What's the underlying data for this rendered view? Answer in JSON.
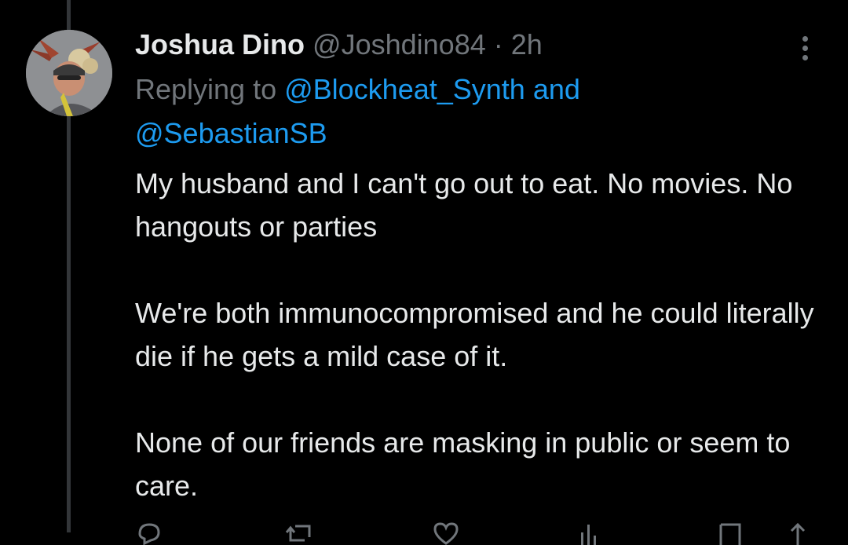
{
  "tweet": {
    "display_name": "Joshua Dino",
    "handle": "@Joshdino84",
    "separator": "·",
    "time": "2h",
    "replying_prefix": "Replying to ",
    "mention_1": "@Blockheat_Synth",
    "mention_joiner": " and",
    "mention_2": "@SebastianSB",
    "paragraphs": [
      "My husband and I can't go out to eat. No movies. No hangouts or parties",
      "We're both immunocompromised and he could literally die if he gets a mild case of it.",
      "None of our friends are masking in public or seem to care."
    ]
  },
  "icons": {
    "more": "more-vertical-icon",
    "reply": "reply-icon",
    "retweet": "retweet-icon",
    "like": "heart-icon",
    "views": "views-icon",
    "bookmark": "bookmark-icon",
    "share": "share-icon"
  },
  "colors": {
    "background": "#000000",
    "primary_text": "#e7e9ea",
    "secondary_text": "#71767b",
    "link": "#1d9bf0",
    "thread_line": "#333639"
  }
}
